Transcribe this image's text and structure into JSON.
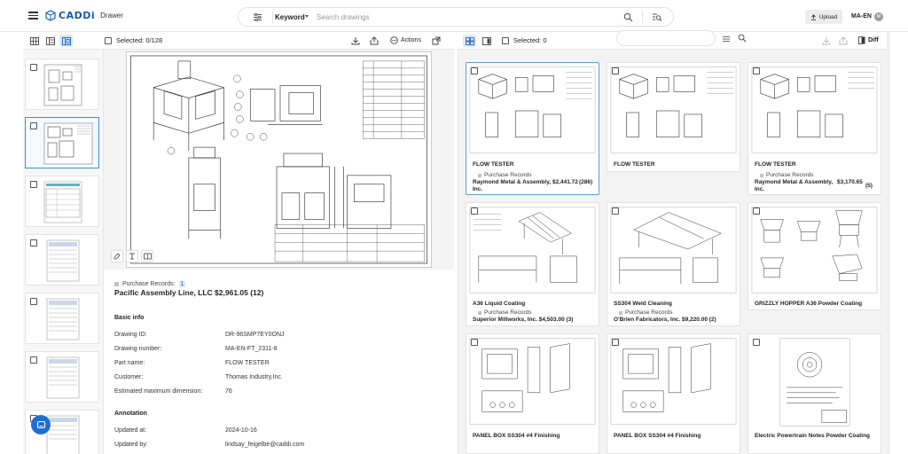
{
  "header": {
    "logo_text": "CADDi",
    "app_name": "Drawer",
    "search": {
      "mode_label": "Keyword",
      "placeholder": "Search drawings"
    },
    "upload_label": "Upload",
    "lang_label": "MA-EN",
    "avatar_initial": "M"
  },
  "left_toolbar": {
    "selected_label": "Selected: 0/128",
    "actions_label": "Actions"
  },
  "right_toolbar": {
    "selected_label": "Selected: 0",
    "diff_label": "Diff"
  },
  "detail": {
    "purchase_records_label": "Purchase Records:",
    "purchase_records_count": "1",
    "company_line": "Pacific Assembly Line, LLC  $2,961.05  (12)",
    "basic_info_title": "Basic info",
    "fields": [
      {
        "label": "Drawing ID:",
        "value": "DR-96SMP7EY0ONJ"
      },
      {
        "label": "Drawing number:",
        "value": "MA-EN-FT_2311-8"
      },
      {
        "label": "Part name:",
        "value": "FLOW TESTER"
      },
      {
        "label": "Customer:",
        "value": "Thomas Industry,Inc."
      },
      {
        "label": "Estimated maximum dimension:",
        "value": "76"
      }
    ],
    "annotation_title": "Annotation",
    "annotation_fields": [
      {
        "label": "Updated at:",
        "value": "2024-10-16"
      },
      {
        "label": "Updated by:",
        "value": "lindsay_feigelbe@caddi.com"
      }
    ]
  },
  "results": [
    {
      "title": "FLOW TESTER",
      "pr_label": "Purchase Records",
      "company": "Raymond Metal & Assembly, Inc.",
      "price": "$2,441.72",
      "count": "(286)"
    },
    {
      "title": "FLOW TESTER",
      "pr_label": "",
      "company": "",
      "price": "",
      "count": ""
    },
    {
      "title": "FLOW TESTER",
      "pr_label": "Purchase Records",
      "company": "Raymond Metal & Assembly, Inc.",
      "price": "$3,170.65",
      "count": "(5)"
    },
    {
      "title": "A36  Liquid Coating",
      "pr_label": "Purchase Records",
      "company": "Superior Millworks, Inc.  $4,503.00  (3)",
      "price": "",
      "count": ""
    },
    {
      "title": "SS304  Weld Cleaning",
      "pr_label": "Purchase Records",
      "company": "O'Brien Fabricators, Inc.  $9,220.00  (2)",
      "price": "",
      "count": ""
    },
    {
      "title": "GRIZZLY HOPPER  A36  Powder Coating",
      "pr_label": "",
      "company": "",
      "price": "",
      "count": ""
    },
    {
      "title": "PANEL BOX  SS304  #4 Finishing",
      "pr_label": "",
      "company": "",
      "price": "",
      "count": ""
    },
    {
      "title": "PANEL BOX  SS304  #4 Finishing",
      "pr_label": "",
      "company": "",
      "price": "",
      "count": ""
    },
    {
      "title": "Electric Powertrain  Notes  Powder Coating",
      "pr_label": "",
      "company": "",
      "price": "",
      "count": ""
    }
  ],
  "colors": {
    "accent": "#1e6fd0",
    "selected_bg": "#dbe8f7",
    "active_border": "#3c8dd8"
  },
  "icons": [
    "menu-icon",
    "logo-cube-icon",
    "filter-icon",
    "search-icon",
    "image-search-icon",
    "upload-icon",
    "grid-view-icon",
    "list-view-icon",
    "split-view-icon",
    "download-icon",
    "share-icon",
    "actions-icon",
    "external-icon",
    "diff-icon",
    "chat-icon"
  ]
}
